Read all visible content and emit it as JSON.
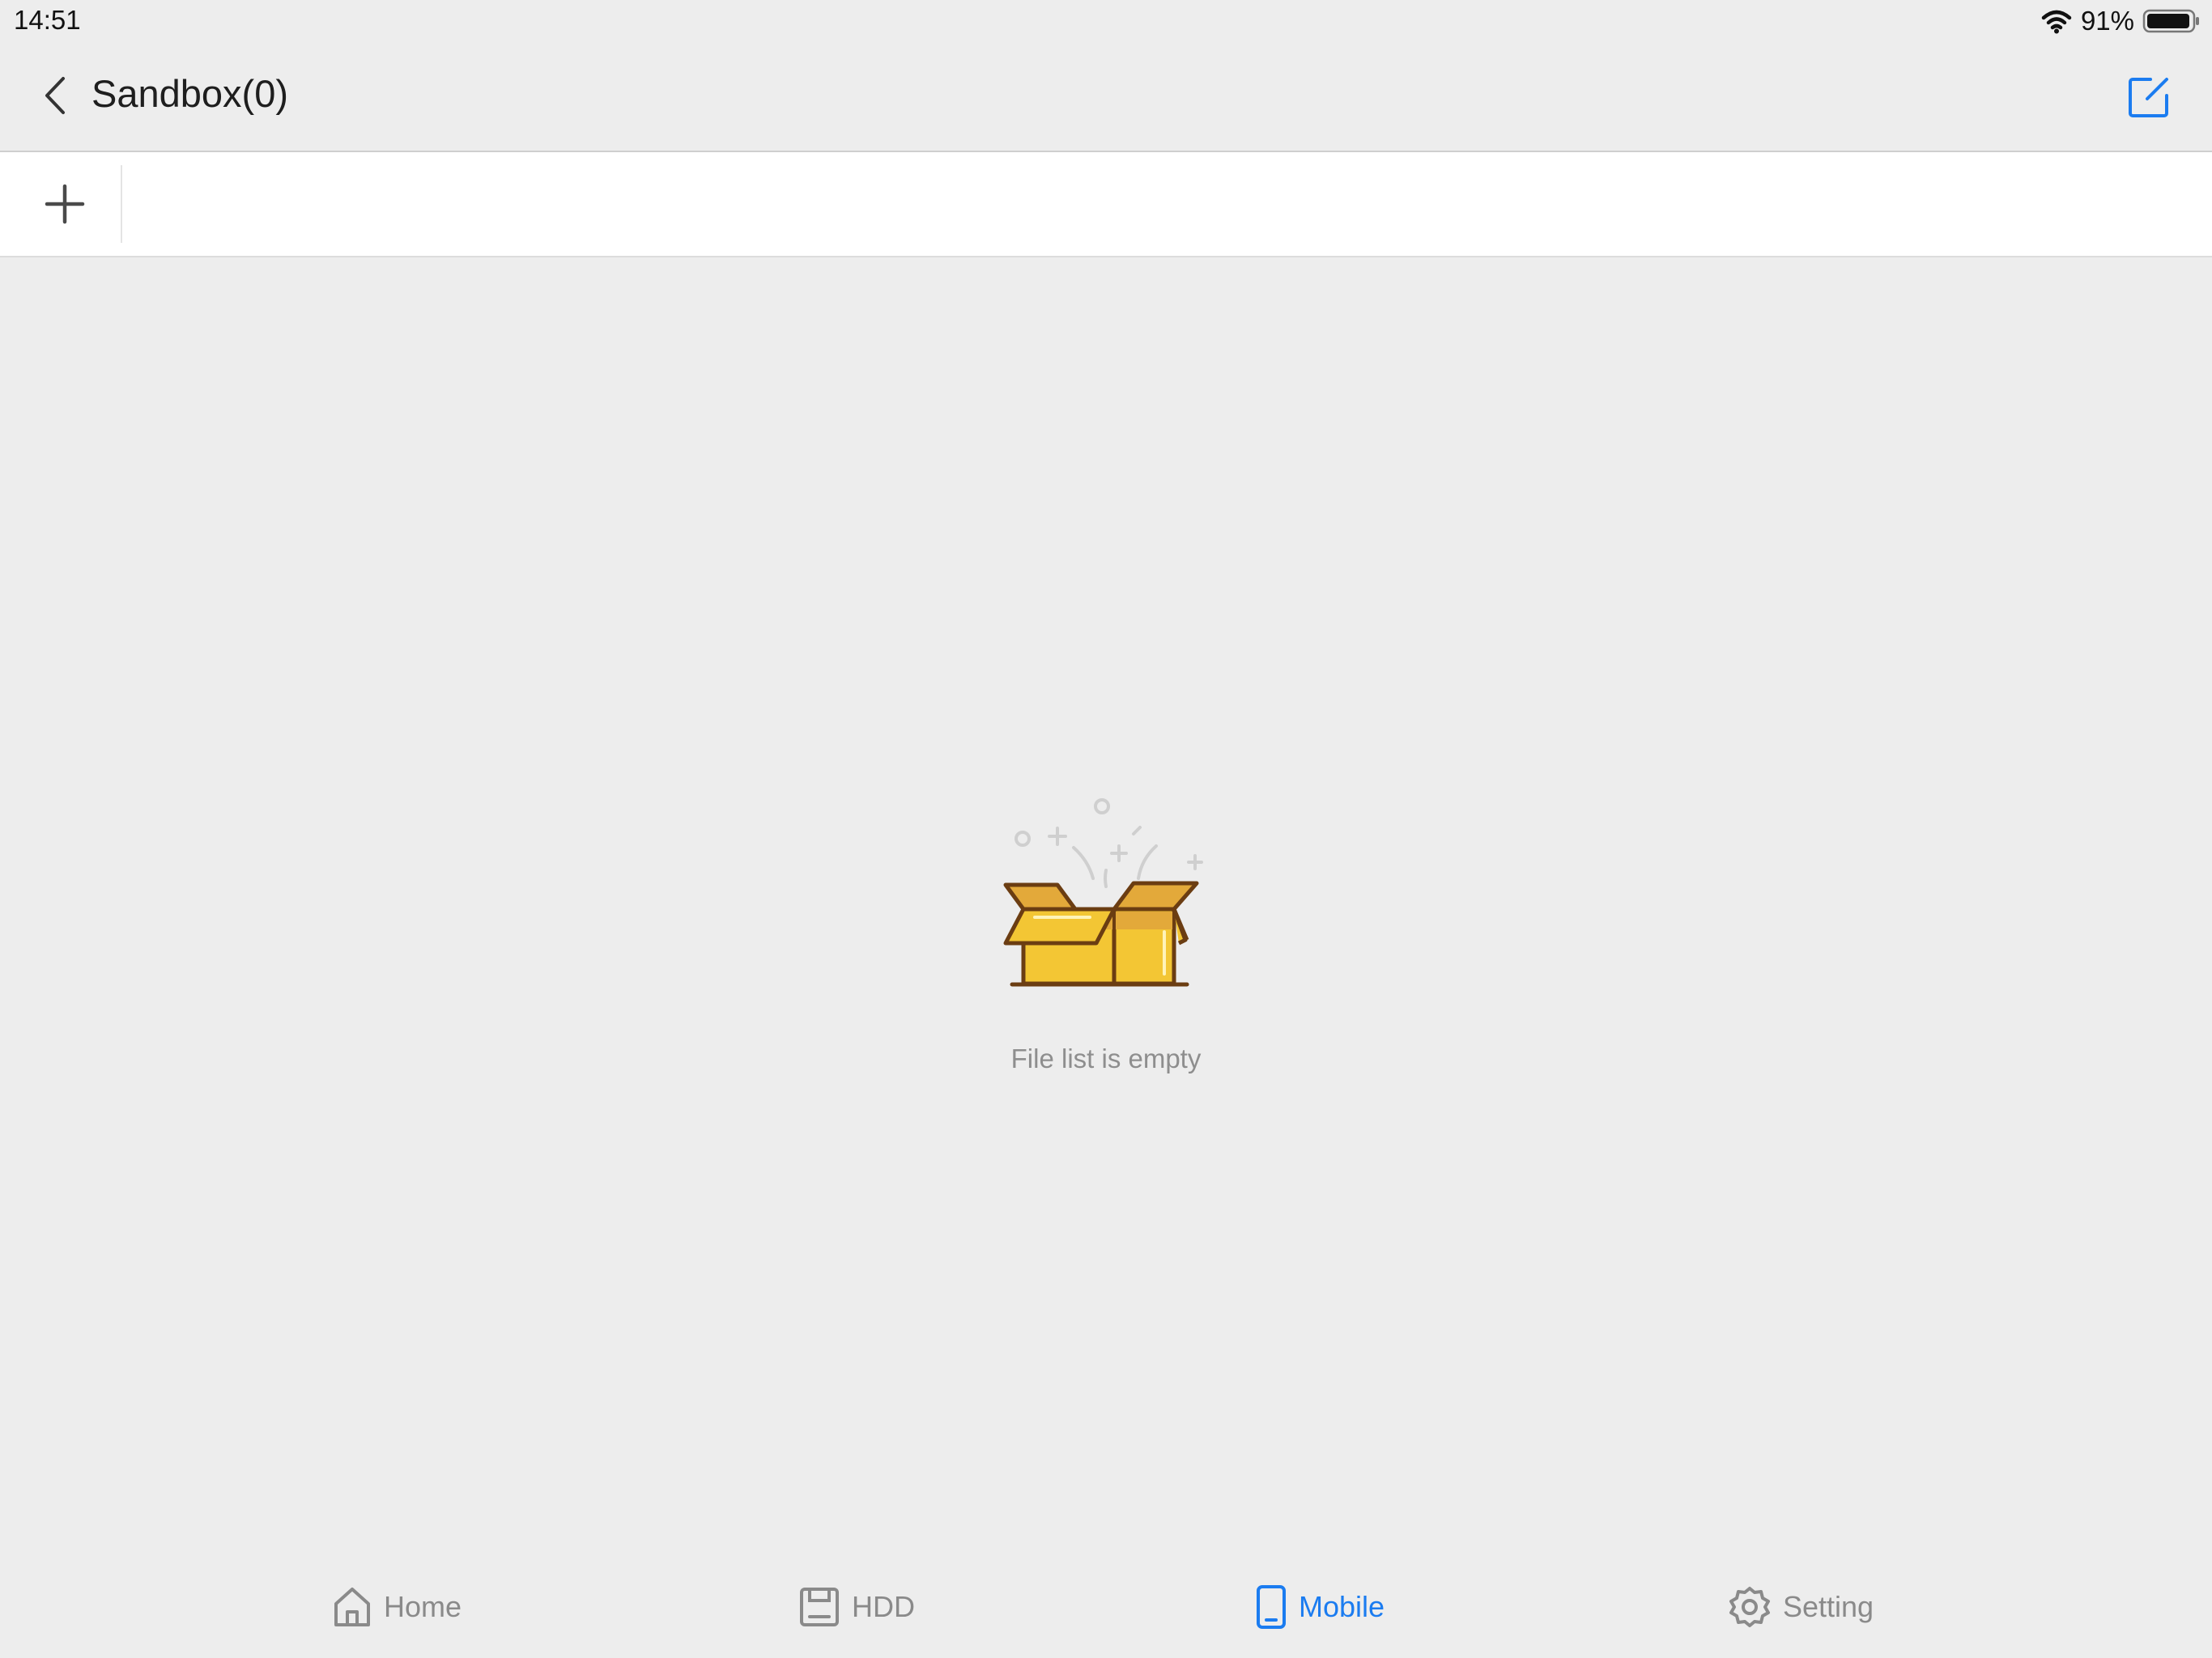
{
  "status_bar": {
    "time": "14:51",
    "battery": "91%"
  },
  "nav": {
    "title": "Sandbox(0)"
  },
  "empty_state": {
    "message": "File list is empty"
  },
  "tabs": [
    {
      "label": "Home",
      "icon": "home-icon",
      "active": false
    },
    {
      "label": "HDD",
      "icon": "hdd-icon",
      "active": false
    },
    {
      "label": "Mobile",
      "icon": "mobile-icon",
      "active": true
    },
    {
      "label": "Setting",
      "icon": "gear-icon",
      "active": false
    }
  ],
  "colors": {
    "accent": "#1b7cf0",
    "inactive": "#8a8a8a",
    "box": "#f3c634",
    "box_outline": "#6b3d12"
  }
}
